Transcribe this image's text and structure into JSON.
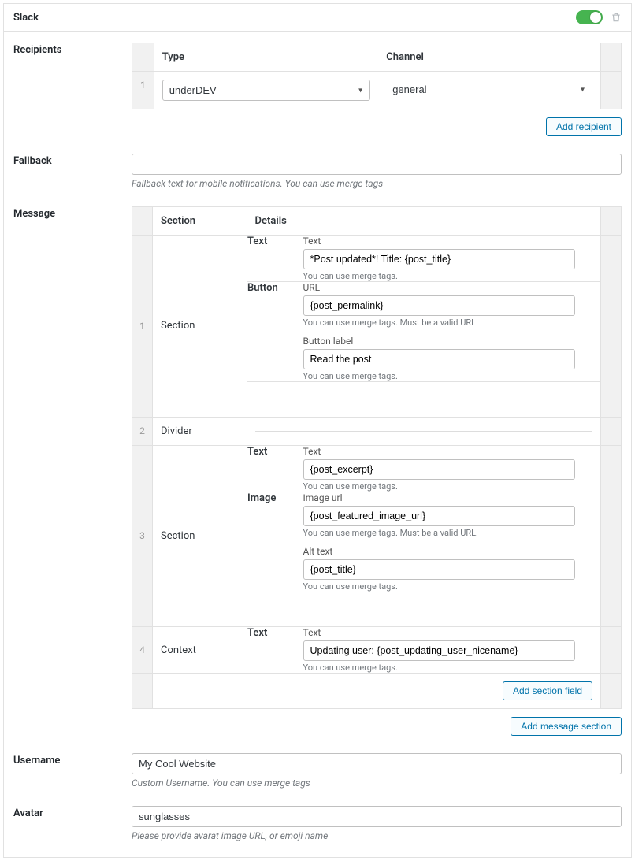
{
  "header": {
    "title": "Slack"
  },
  "labels": {
    "recipients": "Recipients",
    "fallback": "Fallback",
    "message": "Message",
    "username": "Username",
    "avatar": "Avatar"
  },
  "recipients": {
    "type_header": "Type",
    "channel_header": "Channel",
    "row1": {
      "num": "1",
      "type_value": "underDEV",
      "channel_value": "general"
    },
    "add_btn": "Add recipient"
  },
  "fallback": {
    "value": "",
    "help": "Fallback text for mobile notifications. You can use merge tags"
  },
  "message": {
    "section_header": "Section",
    "details_header": "Details",
    "add_section_field": "Add section field",
    "add_message_section": "Add message section",
    "common": {
      "merge_tags": "You can use merge tags.",
      "merge_url": "You can use merge tags. Must be a valid URL."
    },
    "r1": {
      "num": "1",
      "section": "Section",
      "text_label": "Text",
      "button_label": "Button",
      "f_text": {
        "label": "Text",
        "value": "*Post updated*! Title: {post_title}"
      },
      "f_url": {
        "label": "URL",
        "value": "{post_permalink}"
      },
      "f_btn": {
        "label": "Button label",
        "value": "Read the post"
      }
    },
    "r2": {
      "num": "2",
      "section": "Divider"
    },
    "r3": {
      "num": "3",
      "section": "Section",
      "text_label": "Text",
      "image_label": "Image",
      "f_text": {
        "label": "Text",
        "value": "{post_excerpt}"
      },
      "f_img": {
        "label": "Image url",
        "value": "{post_featured_image_url}"
      },
      "f_alt": {
        "label": "Alt text",
        "value": "{post_title}"
      }
    },
    "r4": {
      "num": "4",
      "section": "Context",
      "text_label": "Text",
      "f_text": {
        "label": "Text",
        "value": "Updating user: {post_updating_user_nicename}"
      }
    }
  },
  "username": {
    "value": "My Cool Website",
    "help": "Custom Username. You can use merge tags"
  },
  "avatar": {
    "value": "sunglasses",
    "help": "Please provide avarat image URL, or emoji name"
  }
}
